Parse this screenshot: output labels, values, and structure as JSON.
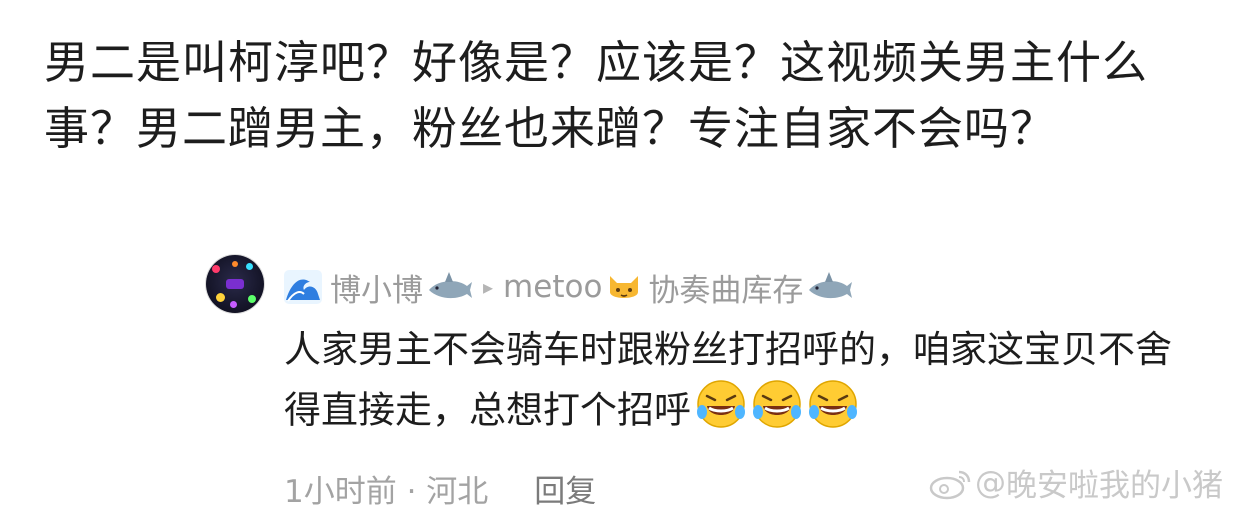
{
  "post": {
    "text": "男二是叫柯淳吧？好像是？应该是？这视频关男主什么事？男二蹭男主，粉丝也来蹭？专注自家不会吗？"
  },
  "comment": {
    "icon_left": "wave-icon",
    "username": "博小博",
    "icon_shark": "shark-icon",
    "reply_arrow": "▸",
    "reply_to": "metoo",
    "icon_cat": "cat-face-icon",
    "reply_suffix": "协奏曲库存",
    "text": "人家男主不会骑车时跟粉丝打招呼的，咱家这宝贝不舍得直接走，总想打个招呼",
    "emoji": "rolling-laughing-icon",
    "time": "1小时前 · 河北",
    "reply_label": "回复"
  },
  "watermark": {
    "prefix": "@",
    "text": "晚安啦我的小猪",
    "icon": "weibo-logo-icon"
  }
}
